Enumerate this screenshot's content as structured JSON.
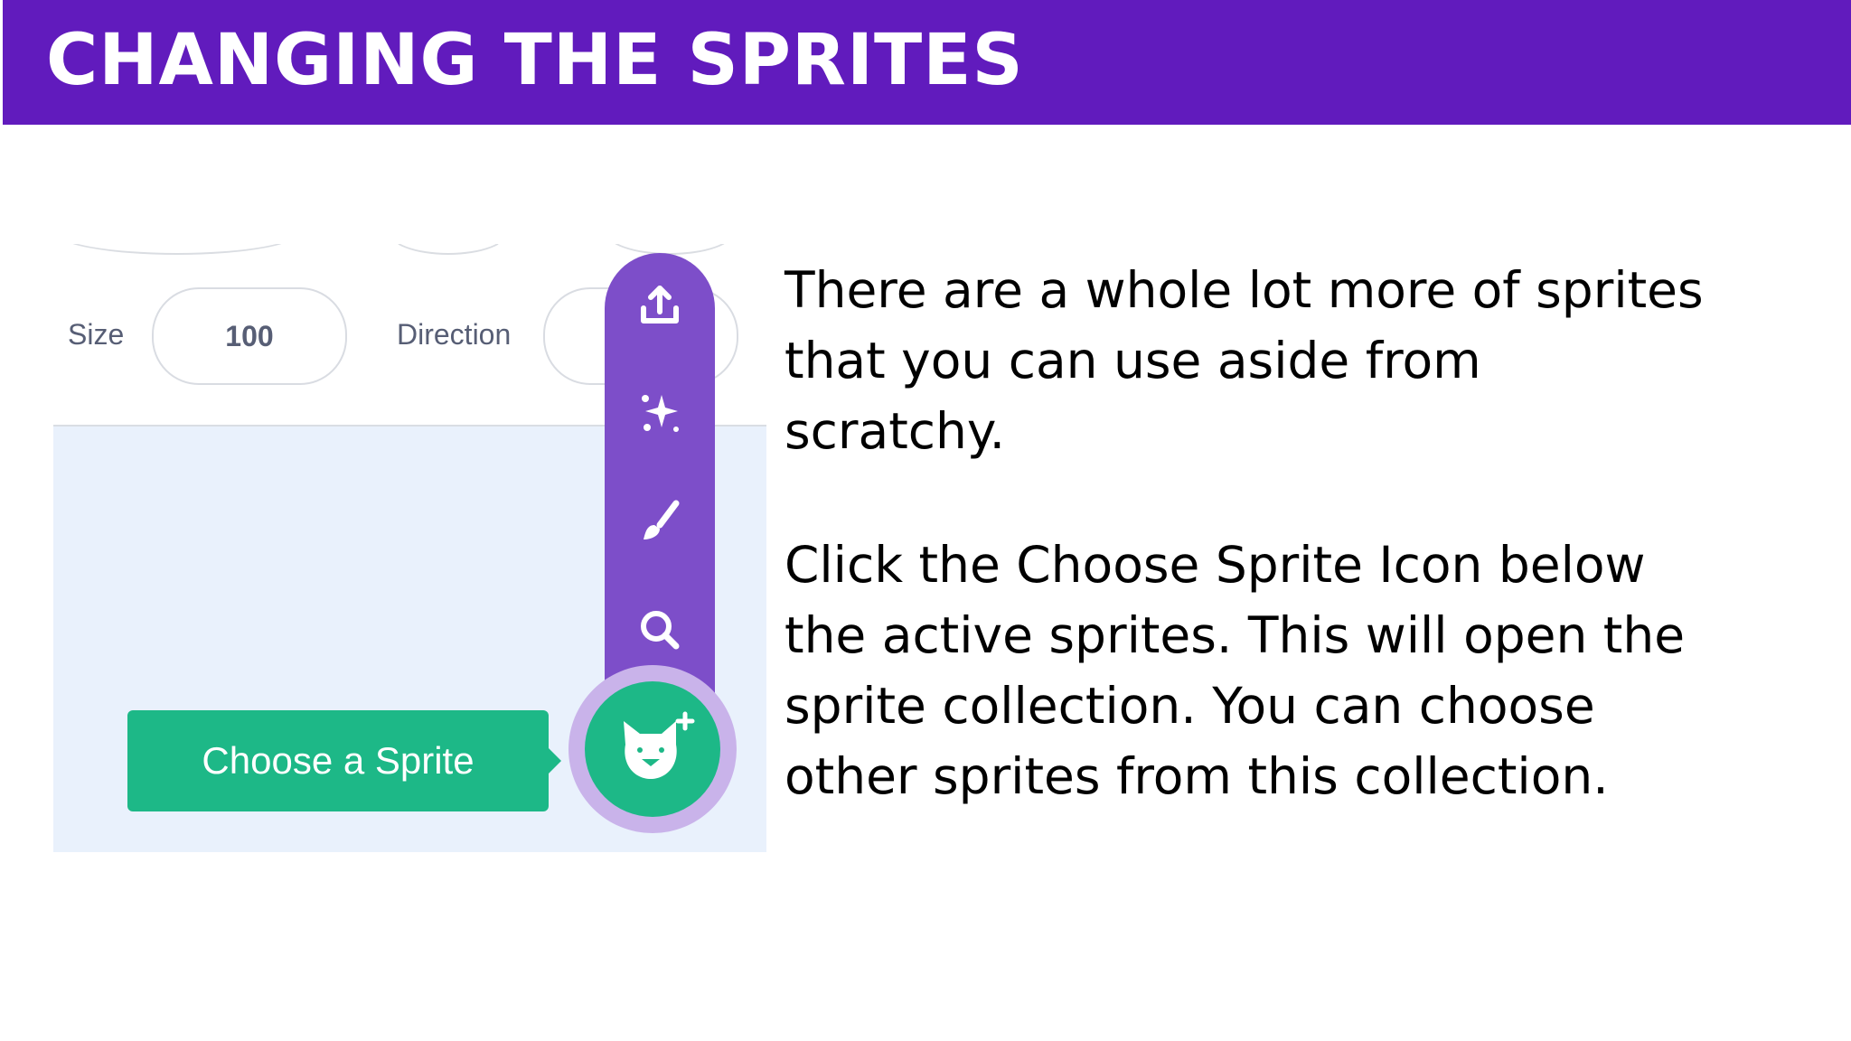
{
  "slide": {
    "title": "CHANGING THE SPRITES",
    "paragraph_1": "There are a whole lot more of sprites that you can use aside from scratchy.",
    "paragraph_2": "Click the Choose Sprite Icon below the active sprites. This will open the sprite collection. You can choose other sprites from this collection."
  },
  "screenshot": {
    "size_label": "Size",
    "size_value": "100",
    "direction_label": "Direction",
    "tooltip": "Choose a Sprite",
    "menu_icons": [
      "upload-icon",
      "surprise-icon",
      "paint-icon",
      "search-icon"
    ],
    "main_icon": "cat-icon",
    "colors": {
      "title_bar": "#611bbd",
      "menu_purple": "#7d4ec9",
      "green": "#1db887",
      "stage_bg": "#e9f1fc"
    }
  }
}
